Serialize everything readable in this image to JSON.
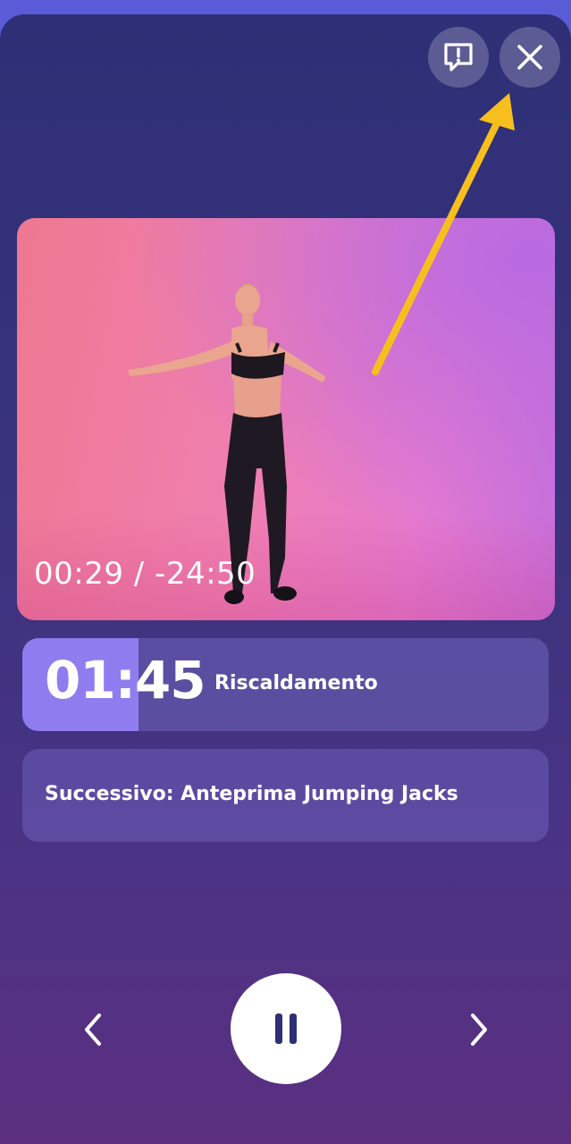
{
  "icons": {
    "report": "report-feedback-icon",
    "close": "close-icon",
    "previous": "chevron-left-icon",
    "pause": "pause-icon",
    "next": "chevron-right-icon"
  },
  "video": {
    "timecode": "00:29 / -24:50"
  },
  "current_exercise": {
    "time": "01:45",
    "name": "Riscaldamento",
    "progress_fraction": 0.22
  },
  "next_exercise": {
    "text": "Successivo: Anteprima Jumping Jacks"
  },
  "colors": {
    "accent": "#8f7df0",
    "annotation_arrow": "#f7bf1e"
  }
}
